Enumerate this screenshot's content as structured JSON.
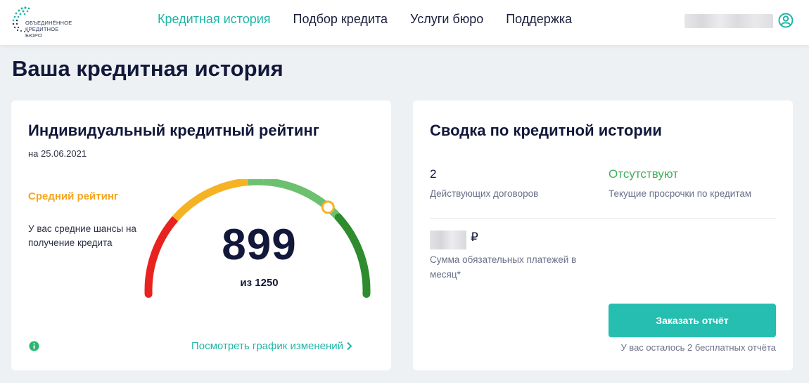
{
  "header": {
    "logo_line1": "ОБЪЕДИНЁННОЕ",
    "logo_line2": "КРЕДИТНОЕ БЮРО",
    "nav": [
      {
        "label": "Кредитная история",
        "active": true
      },
      {
        "label": "Подбор кредита",
        "active": false
      },
      {
        "label": "Услуги бюро",
        "active": false
      },
      {
        "label": "Поддержка",
        "active": false
      }
    ],
    "user_icon": "user-circle-icon"
  },
  "page_title": "Ваша кредитная история",
  "rating_card": {
    "title": "Индивидуальный кредитный рейтинг",
    "date": "на 25.06.2021",
    "rating_label": "Средний рейтинг",
    "rating_description": "У вас средние шансы на получение кредита",
    "score": "899",
    "score_of": "из 1250",
    "score_value": 899,
    "score_max": 1250,
    "link_text": "Посмотреть график изменений",
    "info_icon": "info-icon",
    "colors": {
      "red": "#e8231f",
      "yellow": "#f5b324",
      "light_green": "#6cc070",
      "dark_green": "#2e8b2e",
      "accent": "#1fb5a5"
    }
  },
  "summary_card": {
    "title": "Сводка по кредитной истории",
    "contracts_value": "2",
    "contracts_label": "Действующих договоров",
    "overdue_value": "Отсутствуют",
    "overdue_label": "Текущие просрочки по кредитам",
    "currency": "₽",
    "payments_label": "Сумма обязательных платежей в месяц*",
    "button_label": "Заказать отчёт",
    "remaining_text": "У вас осталось 2 бесплатных отчёта"
  }
}
